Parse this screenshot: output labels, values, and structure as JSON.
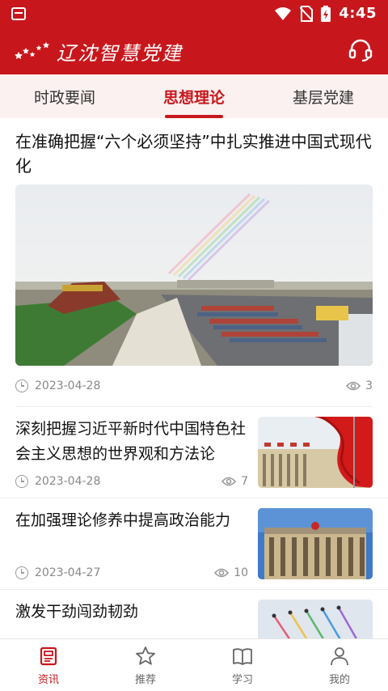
{
  "status_bar": {
    "time": "4:45"
  },
  "header": {
    "logo_text": "辽沈智慧党建",
    "support_icon": "headset-icon"
  },
  "tabs": [
    {
      "label": "时政要闻",
      "active": false
    },
    {
      "label": "思想理论",
      "active": true
    },
    {
      "label": "基层党建",
      "active": false
    }
  ],
  "feed": {
    "featured": {
      "title": "在准确把握“六个必须坚持”中扎实推进中国式现代化",
      "date": "2023-04-28",
      "views": "3"
    },
    "items": [
      {
        "title": "深刻把握习近平新时代中国特色社会主义思想的世界观和方法论",
        "date": "2023-04-28",
        "views": "7"
      },
      {
        "title": "在加强理论修养中提高政治能力",
        "date": "2023-04-27",
        "views": "10"
      },
      {
        "title": "激发干劲闯劲韧劲",
        "date": "",
        "views": ""
      }
    ]
  },
  "bottom_nav": [
    {
      "label": "资讯",
      "icon": "news-icon",
      "active": true
    },
    {
      "label": "推荐",
      "icon": "star-icon",
      "active": false
    },
    {
      "label": "学习",
      "icon": "book-icon",
      "active": false
    },
    {
      "label": "我的",
      "icon": "person-icon",
      "active": false
    }
  ],
  "colors": {
    "brand": "#c8171c",
    "tab_bg": "#fbf1f0"
  }
}
